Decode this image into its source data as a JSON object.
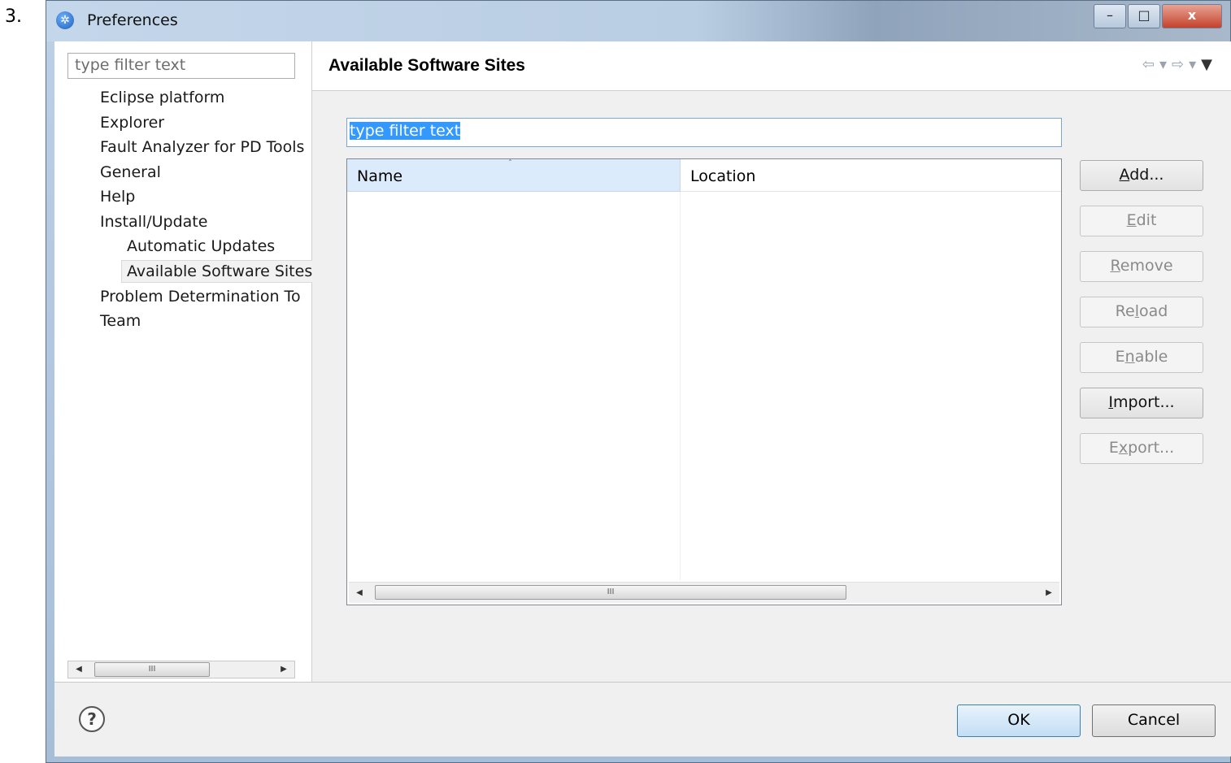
{
  "step_number": "3.",
  "window": {
    "title": "Preferences",
    "title_icon": "eclipse-gear-icon",
    "minimize_glyph": "–",
    "maximize_glyph": "□",
    "close_glyph": "x"
  },
  "sidebar": {
    "filter_placeholder": "type filter text",
    "items": [
      {
        "label": "Eclipse platform"
      },
      {
        "label": "Explorer"
      },
      {
        "label": "Fault Analyzer for PD Tools"
      },
      {
        "label": "General"
      },
      {
        "label": "Help"
      },
      {
        "label": "Install/Update"
      },
      {
        "label": "Automatic Updates"
      },
      {
        "label": "Available Software Sites",
        "selected": true
      },
      {
        "label": "Problem Determination To"
      },
      {
        "label": "Team"
      }
    ],
    "scroll_thumb_glyph": "III"
  },
  "page": {
    "title": "Available Software Sites",
    "nav": {
      "back": "⇦",
      "back_menu": "▾",
      "forward": "⇨",
      "forward_menu": "▾",
      "menu": "▼"
    },
    "filter_value": "type filter text",
    "table": {
      "columns": [
        "Name",
        "Location"
      ],
      "sort_glyph": "ˆ",
      "rows": [],
      "scroll_thumb_glyph": "III"
    },
    "buttons": {
      "add": {
        "mnemonic": "A",
        "rest": "dd..."
      },
      "edit": {
        "mnemonic": "E",
        "rest": "dit"
      },
      "remove": {
        "mnemonic": "R",
        "rest": "emove"
      },
      "reload": {
        "pre": "Re",
        "mnemonic": "l",
        "rest": "oad"
      },
      "enable": {
        "pre": "E",
        "mnemonic": "n",
        "rest": "able"
      },
      "import": {
        "mnemonic": "I",
        "rest": "mport..."
      },
      "export": {
        "pre": "E",
        "mnemonic": "x",
        "rest": "port..."
      }
    }
  },
  "footer": {
    "help_glyph": "?",
    "ok_label": "OK",
    "cancel_label": "Cancel"
  }
}
